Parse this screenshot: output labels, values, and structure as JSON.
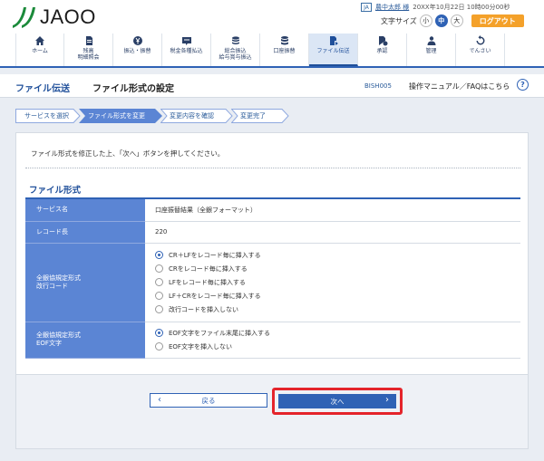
{
  "header": {
    "logo_text": "JAOO",
    "user_icon_label": "JA",
    "user_name": "農中太郎 様",
    "datetime": "20XX年10月22日 10時00分00秒",
    "font_size_label": "文字サイズ",
    "size_small": "小",
    "size_medium": "中",
    "size_large": "大",
    "logout_label": "ログアウト"
  },
  "nav": {
    "items": [
      {
        "line1": "ホーム",
        "line2": ""
      },
      {
        "line1": "残高",
        "line2": "明細照会"
      },
      {
        "line1": "振込・振替",
        "line2": ""
      },
      {
        "line1": "税金各種払込",
        "line2": ""
      },
      {
        "line1": "総合振込",
        "line2": "給与賞与振込"
      },
      {
        "line1": "口座振替",
        "line2": ""
      },
      {
        "line1": "ファイル伝送",
        "line2": ""
      },
      {
        "line1": "承認",
        "line2": ""
      },
      {
        "line1": "管理",
        "line2": ""
      },
      {
        "line1": "でんさい",
        "line2": ""
      }
    ]
  },
  "titlebar": {
    "section": "ファイル伝送",
    "page": "ファイル形式の設定",
    "code": "BISH005",
    "help": "操作マニュアル／FAQはこちら",
    "help_icon": "?"
  },
  "steps": [
    "サービスを選択",
    "ファイル形式を変更",
    "変更内容を確認",
    "変更完了"
  ],
  "main": {
    "instruction": "ファイル形式を修正した上、「次へ」ボタンを押してください。",
    "section_title": "ファイル形式",
    "rows": {
      "service_label": "サービス名",
      "service_value": "口座振替結果（全銀フォーマット）",
      "record_label": "レコード長",
      "record_value": "220",
      "newline_label1": "全銀協規定形式",
      "newline_label2": "改行コード",
      "newline_options": [
        "CR＋LFをレコード毎に挿入する",
        "CRをレコード毎に挿入する",
        "LFをレコード毎に挿入する",
        "LF＋CRをレコード毎に挿入する",
        "改行コードを挿入しない"
      ],
      "newline_selected": 0,
      "eof_label1": "全銀協規定形式",
      "eof_label2": "EOF文字",
      "eof_options": [
        "EOF文字をファイル末尾に挿入する",
        "EOF文字を挿入しない"
      ],
      "eof_selected": 0
    }
  },
  "buttons": {
    "back": "戻る",
    "next": "次へ"
  },
  "colors": {
    "primary": "#2f62b5",
    "accent": "#f4a12a",
    "highlight": "#e4242b",
    "label_bg": "#5b85d4"
  }
}
